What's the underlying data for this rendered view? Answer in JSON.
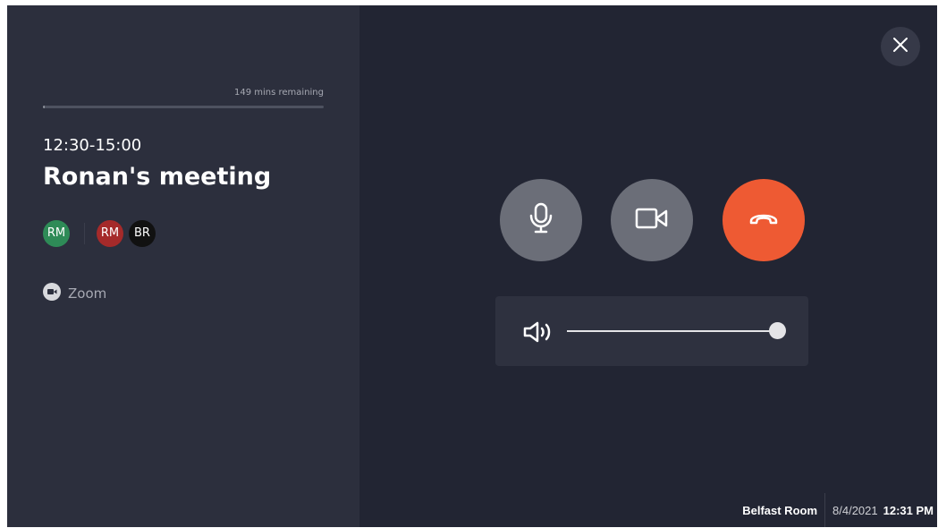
{
  "meeting": {
    "remaining_text": "149 mins remaining",
    "elapsed_fraction": 0.0,
    "time_range": "12:30-15:00",
    "title": "Ronan's meeting",
    "organizer": {
      "initials": "RM",
      "color": "#2e8b57"
    },
    "attendees": [
      {
        "initials": "RM",
        "color": "#a52a2a"
      },
      {
        "initials": "BR",
        "color": "#111111"
      }
    ],
    "provider": {
      "icon": "video-camera-icon",
      "label": "Zoom"
    }
  },
  "controls": {
    "close_icon": "close-icon",
    "mic_icon": "microphone-icon",
    "camera_icon": "video-camera-icon",
    "hangup_icon": "hang-up-icon",
    "button_color": "#6b6e78",
    "hangup_color": "#ee5a33"
  },
  "volume": {
    "icon": "speaker-icon",
    "level": 1.0
  },
  "footer": {
    "room": "Belfast Room",
    "date": "8/4/2021",
    "time": "12:31 PM"
  }
}
